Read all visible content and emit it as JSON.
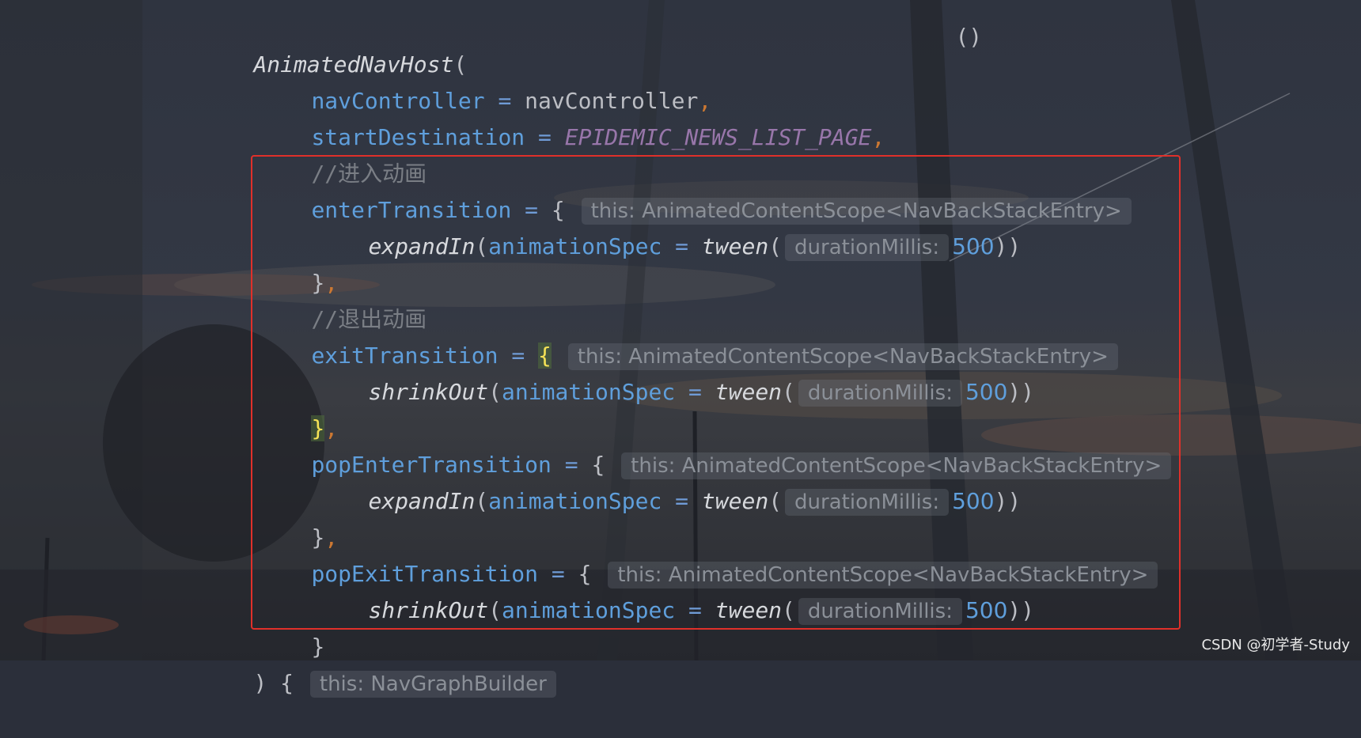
{
  "code": {
    "animated_nav_host": "AnimatedNavHost",
    "open_paren": "(",
    "nav_controller_param": "navController",
    "nav_controller_value": "navController",
    "start_destination_param": "startDestination",
    "start_destination_value": "EPIDEMIC_NEWS_LIST_PAGE",
    "comment_enter": "//进入动画",
    "enter_transition": "enterTransition",
    "comment_exit": "//退出动画",
    "exit_transition": "exitTransition",
    "pop_enter_transition": "popEnterTransition",
    "pop_exit_transition": "popExitTransition",
    "expand_in": "expandIn",
    "shrink_out": "shrinkOut",
    "animation_spec": "animationSpec",
    "tween": "tween",
    "duration_value": "500",
    "scope_hint": "this: AnimatedContentScope<NavBackStackEntry>",
    "duration_hint": "durationMillis:",
    "builder_hint": "this: NavGraphBuilder",
    "equals": "=",
    "comma": ",",
    "open_brace": "{",
    "close_brace": "}",
    "close_parens": "))",
    "close_paren": ")",
    "top_fragment": "()"
  },
  "watermark": "CSDN @初学者-Study",
  "colors": {
    "highlight_border": "#e0302a",
    "param": "#5f9fdc",
    "comma": "#cc7832",
    "constant": "#9876aa",
    "comment": "#7a7e85"
  }
}
